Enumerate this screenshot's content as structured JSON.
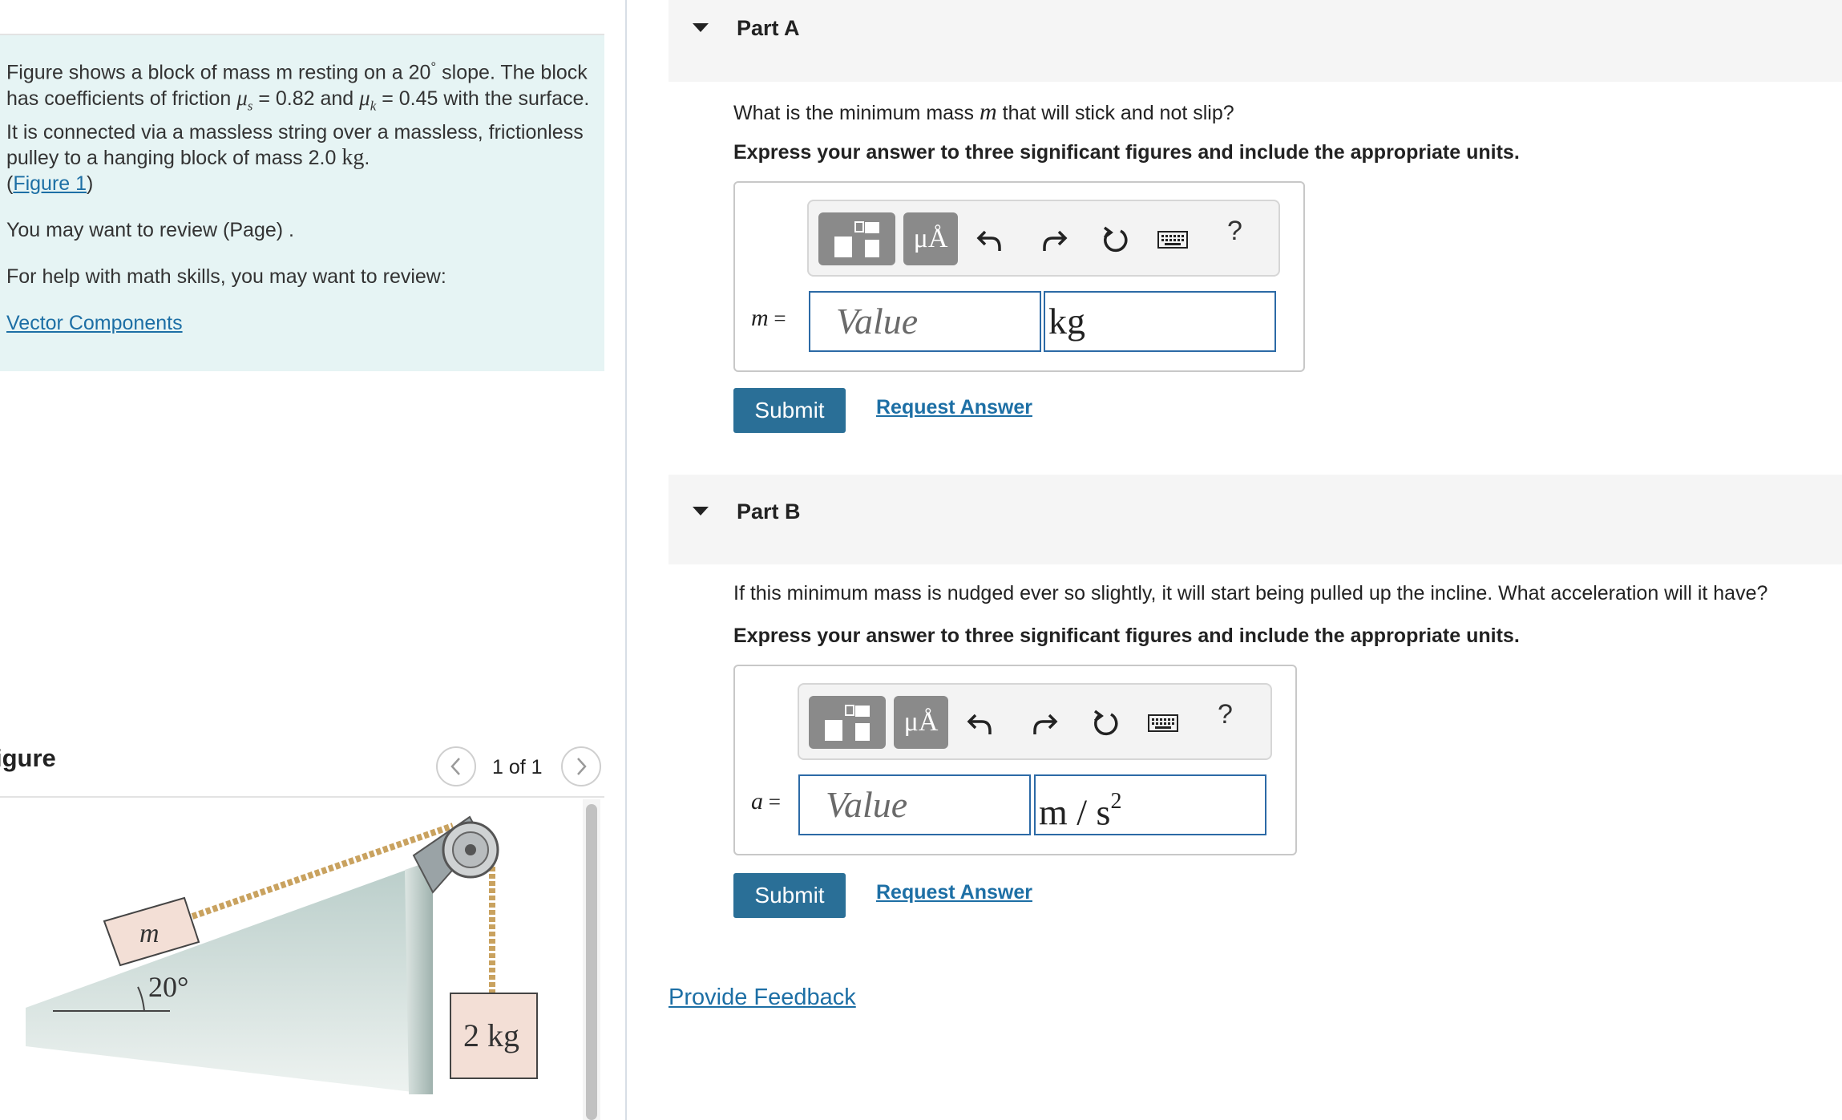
{
  "problem": {
    "sentence_a": "Figure shows a block of mass m resting on a 20",
    "degree_mark": "°",
    "sentence_b": " slope. The block has coefficients of friction ",
    "mu_s_symbol": "μ",
    "mu_s_sub": "s",
    "mu_s_eq": " = 0.82 and ",
    "mu_k_symbol": "μ",
    "mu_k_sub": "k",
    "mu_k_eq": " = 0.45 with the surface. It is connected via a massless string over a massless, frictionless pulley to a hanging block of mass 2.0 ",
    "mass_unit": "kg",
    "period": ".",
    "figure_link_open": "(",
    "figure_link": "Figure 1",
    "figure_link_close": ")",
    "review_text": "You may want to review (Page) .",
    "help_text": "For help with math skills, you may want to review:",
    "vector_link": "Vector Components"
  },
  "figure": {
    "title": "igure",
    "pager": "1 of 1",
    "block_label": "m",
    "angle_label": "20°",
    "hanging_label": "2 kg"
  },
  "partA": {
    "title": "Part A",
    "question_pre": "What is the minimum mass ",
    "question_var": "m",
    "question_post": " that will stick and not slip?",
    "instruction": "Express your answer to three significant figures and include the appropriate units.",
    "var_name": "m",
    "var_eq": " =",
    "value_placeholder": "Value",
    "unit_value": "kg",
    "submit": "Submit",
    "request": "Request Answer"
  },
  "partB": {
    "title": "Part B",
    "question": "If this minimum mass is nudged ever so slightly, it will start being pulled up the incline. What acceleration will it have?",
    "instruction": "Express your answer to three significant figures and include the appropriate units.",
    "var_name": "a",
    "var_eq": " =",
    "value_placeholder": "Value",
    "unit_value": "m / s",
    "unit_exponent": "2",
    "submit": "Submit",
    "request": "Request Answer"
  },
  "toolbar": {
    "mu_label": "μÅ",
    "help_label": "?"
  },
  "feedback": "Provide Feedback"
}
